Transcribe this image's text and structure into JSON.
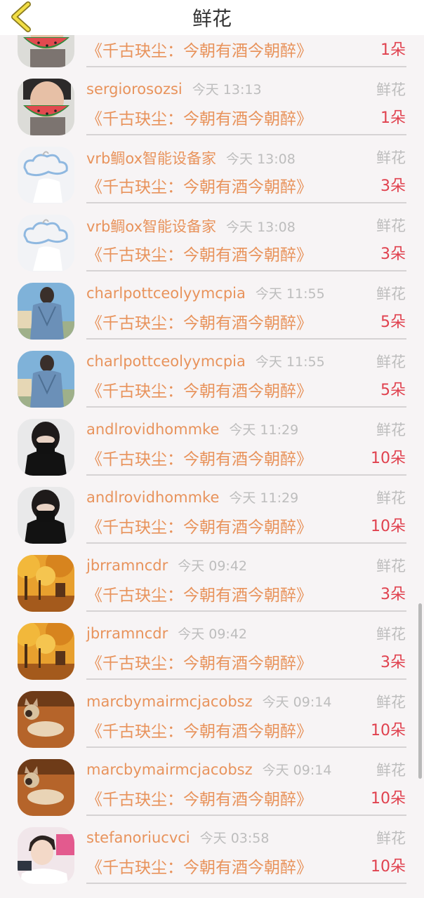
{
  "header": {
    "title": "鲜花"
  },
  "colors": {
    "accent": "#e8935c",
    "count": "#e0414e",
    "muted": "#bdbdbd",
    "background": "#f7f4f5"
  },
  "rows": [
    {
      "username": "sergiorosozsi",
      "time": "今天 13:13",
      "gift": "鲜花",
      "book": "《千古玦尘：今朝有酒今朝醉》",
      "count": "1朵",
      "avatar": "man-watermelon"
    },
    {
      "username": "sergiorosozsi",
      "time": "今天 13:13",
      "gift": "鲜花",
      "book": "《千古玦尘：今朝有酒今朝醉》",
      "count": "1朵",
      "avatar": "man-watermelon"
    },
    {
      "username": "vrb鲷ox智能设备家",
      "time": "今天 13:08",
      "gift": "鲜花",
      "book": "《千古玦尘：今朝有酒今朝醉》",
      "count": "3朵",
      "avatar": "cloud-hanger"
    },
    {
      "username": "vrb鲷ox智能设备家",
      "time": "今天 13:08",
      "gift": "鲜花",
      "book": "《千古玦尘：今朝有酒今朝醉》",
      "count": "3朵",
      "avatar": "cloud-hanger"
    },
    {
      "username": "charlpottceolyymcpia",
      "time": "今天 11:55",
      "gift": "鲜花",
      "book": "《千古玦尘：今朝有酒今朝醉》",
      "count": "5朵",
      "avatar": "denim-man"
    },
    {
      "username": "charlpottceolyymcpia",
      "time": "今天 11:55",
      "gift": "鲜花",
      "book": "《千古玦尘：今朝有酒今朝醉》",
      "count": "5朵",
      "avatar": "denim-man"
    },
    {
      "username": "andlrovidhommke",
      "time": "今天 11:29",
      "gift": "鲜花",
      "book": "《千古玦尘：今朝有酒今朝醉》",
      "count": "10朵",
      "avatar": "black-mask"
    },
    {
      "username": "andlrovidhommke",
      "time": "今天 11:29",
      "gift": "鲜花",
      "book": "《千古玦尘：今朝有酒今朝醉》",
      "count": "10朵",
      "avatar": "black-mask"
    },
    {
      "username": "jbrramncdr",
      "time": "今天 09:42",
      "gift": "鲜花",
      "book": "《千古玦尘：今朝有酒今朝醉》",
      "count": "3朵",
      "avatar": "autumn-trees"
    },
    {
      "username": "jbrramncdr",
      "time": "今天 09:42",
      "gift": "鲜花",
      "book": "《千古玦尘：今朝有酒今朝醉》",
      "count": "3朵",
      "avatar": "autumn-trees"
    },
    {
      "username": "marcbymairmcjacobsz",
      "time": "今天 09:14",
      "gift": "鲜花",
      "book": "《千古玦尘：今朝有酒今朝醉》",
      "count": "10朵",
      "avatar": "dog"
    },
    {
      "username": "marcbymairmcjacobsz",
      "time": "今天 09:14",
      "gift": "鲜花",
      "book": "《千古玦尘：今朝有酒今朝醉》",
      "count": "10朵",
      "avatar": "dog"
    },
    {
      "username": "stefanoriucvci",
      "time": "今天 03:58",
      "gift": "鲜花",
      "book": "《千古玦尘：今朝有酒今朝醉》",
      "count": "10朵",
      "avatar": "boy-selfie"
    }
  ]
}
